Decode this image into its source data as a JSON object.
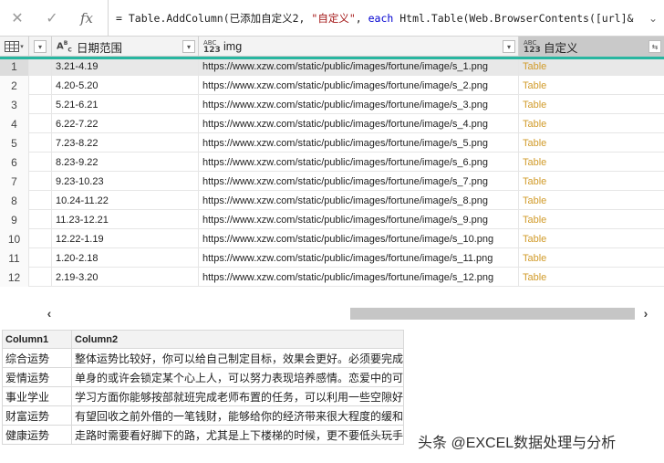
{
  "formula_bar": {
    "cancel_icon": "close-icon",
    "confirm_icon": "check-icon",
    "fx_label": "fx",
    "prefix": "= Table.AddColumn(已添加自定义2, ",
    "string_literal": "\"自定义\"",
    "comma": ", ",
    "keyword": "each",
    "suffix": " Html.Table(Web.BrowserContents([url]&"
  },
  "grid": {
    "columns": [
      {
        "name": "日期范围",
        "type": "ABC",
        "type2": ""
      },
      {
        "name": "img",
        "type": "ABC",
        "type2": "123"
      },
      {
        "name": "自定义",
        "type": "ABC",
        "type2": "123"
      }
    ],
    "rows": [
      {
        "n": "1",
        "date": "3.21-4.19",
        "img": "https://www.xzw.com/static/public/images/fortune/image/s_1.png",
        "custom": "Table"
      },
      {
        "n": "2",
        "date": "4.20-5.20",
        "img": "https://www.xzw.com/static/public/images/fortune/image/s_2.png",
        "custom": "Table"
      },
      {
        "n": "3",
        "date": "5.21-6.21",
        "img": "https://www.xzw.com/static/public/images/fortune/image/s_3.png",
        "custom": "Table"
      },
      {
        "n": "4",
        "date": "6.22-7.22",
        "img": "https://www.xzw.com/static/public/images/fortune/image/s_4.png",
        "custom": "Table"
      },
      {
        "n": "5",
        "date": "7.23-8.22",
        "img": "https://www.xzw.com/static/public/images/fortune/image/s_5.png",
        "custom": "Table"
      },
      {
        "n": "6",
        "date": "8.23-9.22",
        "img": "https://www.xzw.com/static/public/images/fortune/image/s_6.png",
        "custom": "Table"
      },
      {
        "n": "7",
        "date": "9.23-10.23",
        "img": "https://www.xzw.com/static/public/images/fortune/image/s_7.png",
        "custom": "Table"
      },
      {
        "n": "8",
        "date": "10.24-11.22",
        "img": "https://www.xzw.com/static/public/images/fortune/image/s_8.png",
        "custom": "Table"
      },
      {
        "n": "9",
        "date": "11.23-12.21",
        "img": "https://www.xzw.com/static/public/images/fortune/image/s_9.png",
        "custom": "Table"
      },
      {
        "n": "10",
        "date": "12.22-1.19",
        "img": "https://www.xzw.com/static/public/images/fortune/image/s_10.png",
        "custom": "Table"
      },
      {
        "n": "11",
        "date": "1.20-2.18",
        "img": "https://www.xzw.com/static/public/images/fortune/image/s_11.png",
        "custom": "Table"
      },
      {
        "n": "12",
        "date": "2.19-3.20",
        "img": "https://www.xzw.com/static/public/images/fortune/image/s_12.png",
        "custom": "Table"
      }
    ]
  },
  "preview_table": {
    "headers": [
      "Column1",
      "Column2"
    ],
    "rows": [
      [
        "综合运势",
        "整体运势比较好，你可以给自己制定目标，效果会更好。必须要完成"
      ],
      [
        "爱情运势",
        "单身的或许会锁定某个心上人，可以努力表现培养感情。恋爱中的可"
      ],
      [
        "事业学业",
        "学习方面你能够按部就班完成老师布置的任务，可以利用一些空隙好"
      ],
      [
        "财富运势",
        "有望回收之前外借的一笔钱财，能够给你的经济带来很大程度的缓和"
      ],
      [
        "健康运势",
        "走路时需要看好脚下的路，尤其是上下楼梯的时候，更不要低头玩手"
      ]
    ]
  },
  "watermark": "头条 @EXCEL数据处理与分析",
  "colors": {
    "accent": "#28b6a0",
    "table_link": "#d19b2a"
  }
}
